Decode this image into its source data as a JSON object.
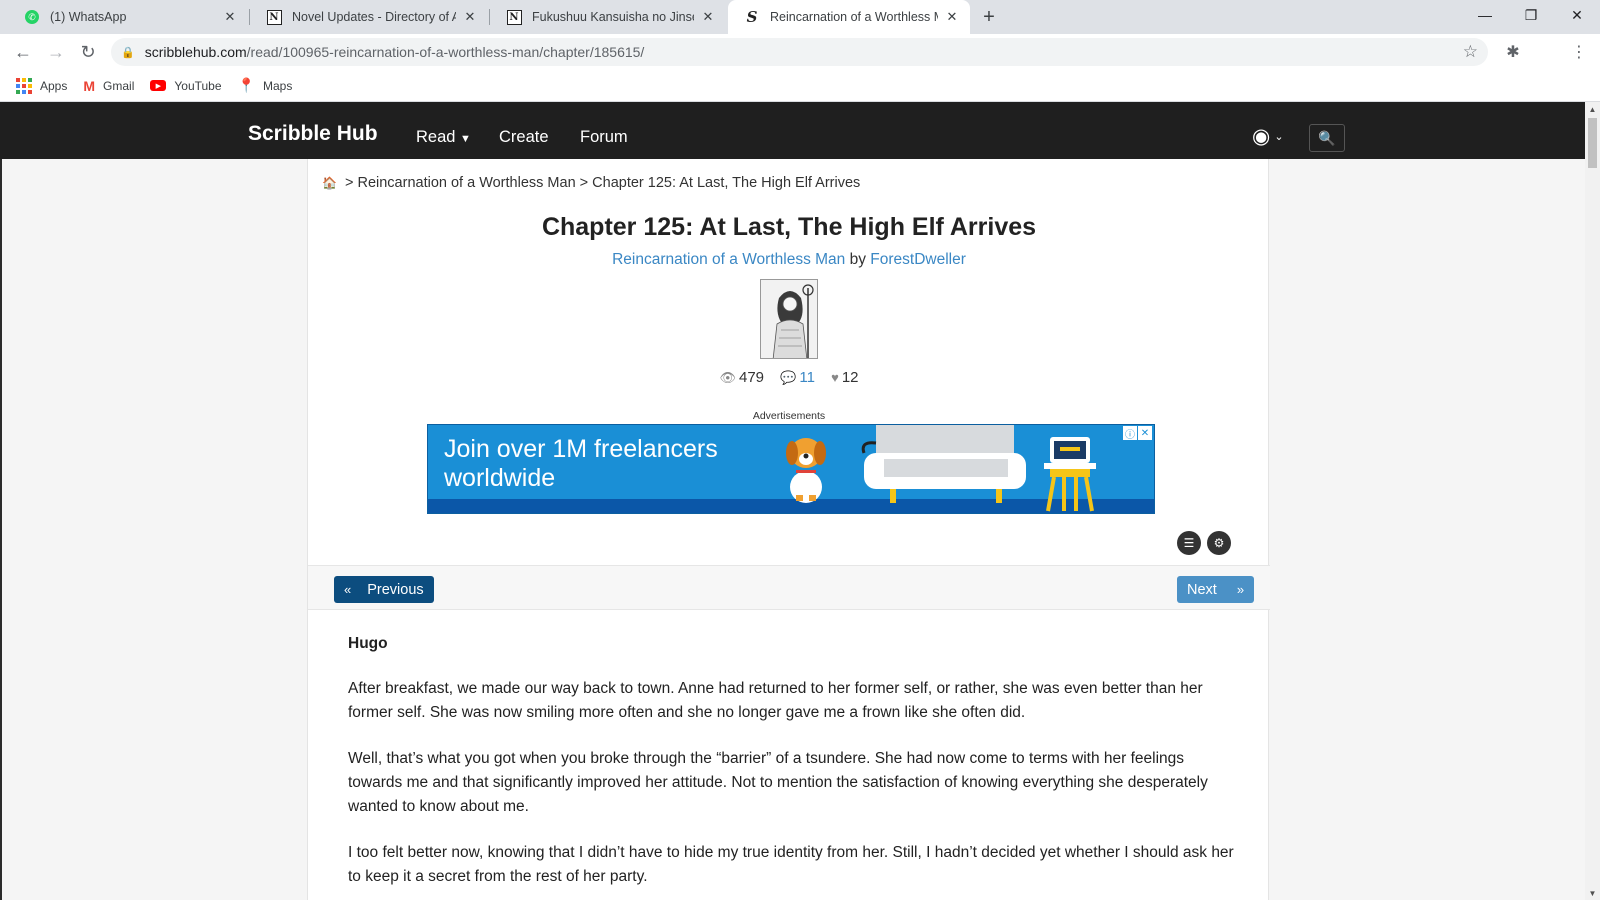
{
  "browser": {
    "tabs": [
      {
        "title": "(1) WhatsApp",
        "favicon": "whatsapp-icon",
        "active": false
      },
      {
        "title": "Novel Updates - Directory of Asia",
        "favicon": "novelupdates-icon",
        "active": false
      },
      {
        "title": "Fukushuu Kansuisha no Jinsei Ni",
        "favicon": "novelupdates-icon",
        "active": false
      },
      {
        "title": "Reincarnation of a Worthless Ma",
        "favicon": "scribblehub-icon",
        "active": true
      }
    ],
    "address": {
      "host": "scribblehub.com",
      "path": "/read/100965-reincarnation-of-a-worthless-man/chapter/185615/"
    },
    "bookmarks": [
      {
        "label": "Apps",
        "icon": "apps-grid-icon"
      },
      {
        "label": "Gmail",
        "icon": "gmail-icon"
      },
      {
        "label": "YouTube",
        "icon": "youtube-icon"
      },
      {
        "label": "Maps",
        "icon": "maps-icon"
      }
    ]
  },
  "site": {
    "brand": "Scribble Hub",
    "nav": {
      "read": "Read",
      "create": "Create",
      "forum": "Forum"
    }
  },
  "breadcrumb": {
    "separator": ">",
    "series": "Reincarnation of a Worthless Man",
    "chapter": "Chapter 125: At Last, The High Elf Arrives"
  },
  "chapter": {
    "title": "Chapter 125: At Last, The High Elf Arrives",
    "series": "Reincarnation of a Worthless Man",
    "by": "by",
    "author": "ForestDweller",
    "stats": {
      "views": "479",
      "comments": "11",
      "likes": "12"
    },
    "pov": "Hugo",
    "paragraphs": [
      "After breakfast, we made our way back to town. Anne had returned to her former self, or rather, she was even better than her former self. She was now smiling more often and she no longer gave me a frown like she often did.",
      "Well, that’s what you got when you broke through the “barrier” of a tsundere. She had now come to terms with her feelings towards me and that significantly improved her attitude. Not to mention the satisfaction of knowing everything she desperately wanted to know about me.",
      "I too felt better now, knowing that I didn’t have to hide my true identity from her. Still, I hadn’t decided yet whether I should ask her to keep it a secret from the rest of her party."
    ]
  },
  "ad": {
    "label": "Advertisements",
    "headline_line1": "Join over 1M freelancers",
    "headline_line2": "worldwide"
  },
  "pager": {
    "previous": "Previous",
    "next": "Next",
    "prev_arrows": "«",
    "next_arrows": "»"
  },
  "colors": {
    "nav_bg": "#1f1f1f",
    "link": "#3a87c4",
    "prev_button": "#0c4d7f",
    "next_button": "#4b91c6",
    "ad_bg": "#1a8fd6"
  }
}
